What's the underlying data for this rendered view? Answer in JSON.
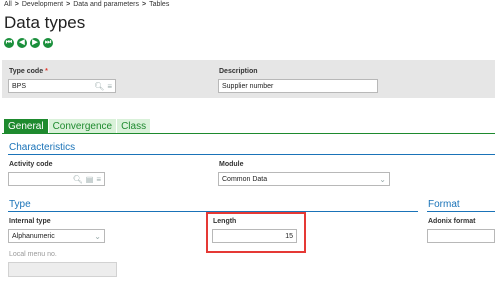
{
  "breadcrumb": [
    "All",
    "Development",
    "Data and parameters",
    "Tables"
  ],
  "breadcrumb_separator": ">",
  "page_title": "Data types",
  "nav_buttons": [
    "first-icon",
    "previous-icon",
    "next-icon",
    "last-icon"
  ],
  "header": {
    "type_code_label": "Type code",
    "type_code_value": "BPS",
    "description_label": "Description",
    "description_value": "Supplier number"
  },
  "tabs": [
    {
      "label": "General",
      "active": true
    },
    {
      "label": "Convergence",
      "active": false
    },
    {
      "label": "Class",
      "active": false
    }
  ],
  "characteristics": {
    "title": "Characteristics",
    "activity_code_label": "Activity code",
    "activity_code_value": "",
    "module_label": "Module",
    "module_value": "Common Data"
  },
  "type_section": {
    "title": "Type",
    "internal_type_label": "Internal type",
    "internal_type_value": "Alphanumeric",
    "length_label": "Length",
    "length_value": "15",
    "local_menu_label": "Local menu no.",
    "local_menu_value": ""
  },
  "format_section": {
    "title": "Format",
    "adonix_format_label": "Adonix format",
    "adonix_format_value": ""
  },
  "colors": {
    "accent_green": "#1e8a2e",
    "section_blue": "#1a73b8",
    "highlight_red": "#e53935",
    "required_red": "#e23b2f"
  }
}
